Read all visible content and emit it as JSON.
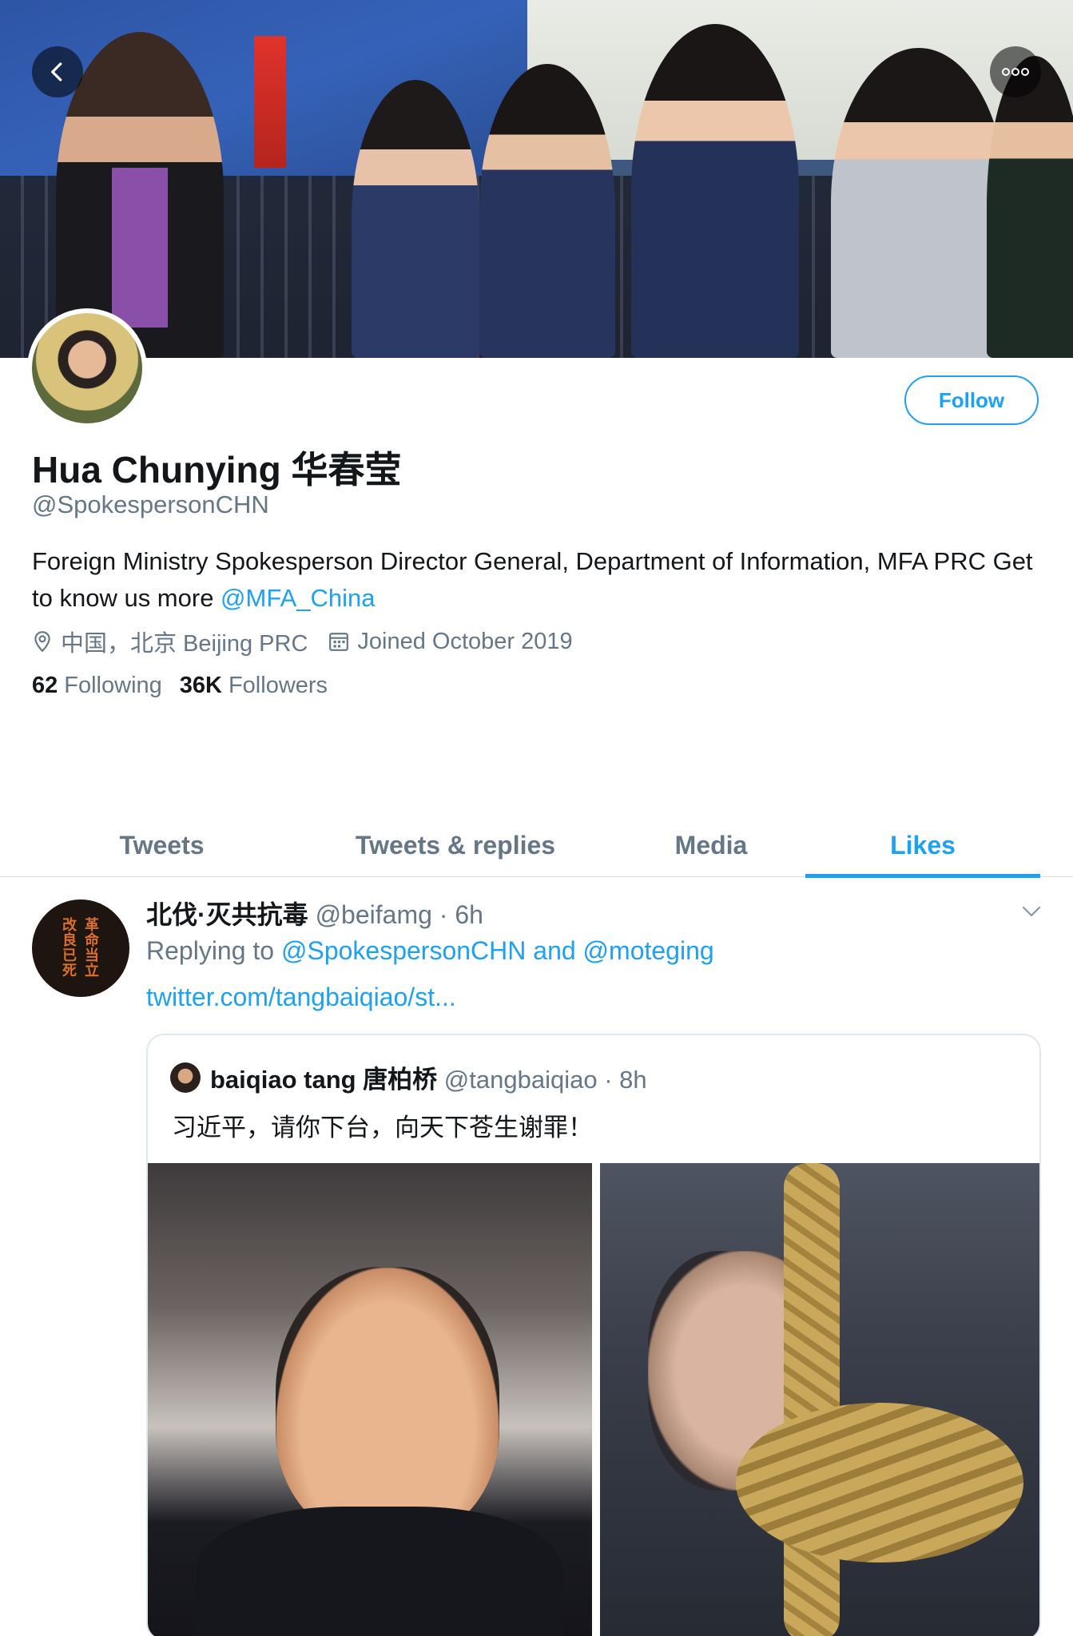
{
  "profile": {
    "name": "Hua Chunying 华春莹",
    "handle": "@SpokespersonCHN",
    "bio_text": "Foreign Ministry Spokesperson Director General, Department of Information, MFA PRC Get to know us more ",
    "bio_link": "@MFA_China",
    "location": "中国，北京 Beijing PRC",
    "joined": "Joined October 2019",
    "following_count": "62",
    "following_label": "Following",
    "followers_count": "36K",
    "followers_label": "Followers",
    "follow_button": "Follow"
  },
  "tabs": [
    {
      "label": "Tweets",
      "active": false
    },
    {
      "label": "Tweets & replies",
      "active": false
    },
    {
      "label": "Media",
      "active": false
    },
    {
      "label": "Likes",
      "active": true
    }
  ],
  "tweet": {
    "author_name": "北伐·灭共抗毒",
    "author_meta": " @beifamg · 6h",
    "avatar_chars": [
      "改",
      "革",
      "良",
      "命",
      "已",
      "当",
      "死",
      "立"
    ],
    "replying_prefix": "Replying to ",
    "replying_users": "@SpokespersonCHN and @moteging",
    "link": "twitter.com/tangbaiqiao/st...",
    "quote": {
      "author_name": "baiqiao tang 唐柏桥",
      "author_meta": " @tangbaiqiao · 8h",
      "text": "习近平，请你下台，向天下苍生谢罪！"
    }
  },
  "colors": {
    "accent": "#1da1f2",
    "secondary_text": "#657786",
    "primary_text": "#14171a"
  },
  "icons": {
    "back": "chevron-left-icon",
    "more": "more-horizontal-icon",
    "location": "location-pin-icon",
    "calendar": "calendar-icon",
    "caret": "chevron-down-icon"
  }
}
